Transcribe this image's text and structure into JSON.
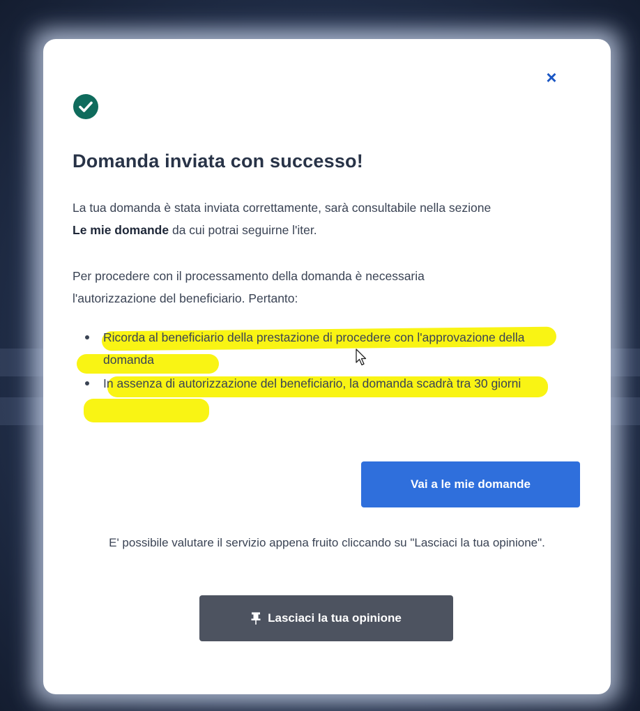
{
  "modal": {
    "close_label": "×",
    "icon": "check-circle-icon",
    "title": "Domanda inviata con successo!",
    "paragraph1": {
      "before": "La tua domanda è stata inviata correttamente, sarà consultabile nella sezione",
      "bold": "Le mie domande",
      "after": "da cui potrai seguirne l'iter."
    },
    "paragraph2": "Per procedere con il processamento della domanda è necessaria l'autorizzazione del beneficiario. Pertanto:",
    "bullets": [
      "Ricorda al beneficiario della prestazione di procedere con l'approvazione della domanda",
      "In assenza di autorizzazione del beneficiario, la domanda scadrà tra 30 giorni"
    ],
    "primary_button": "Vai a le mie domande",
    "feedback_text": "E' possibile valutare il servizio appena fruito cliccando su \"Lasciaci la tua opinione\".",
    "feedback_button": {
      "icon": "pin-icon",
      "label": "Lasciaci la tua opinione"
    }
  },
  "colors": {
    "success": "#0f6b5c",
    "primary": "#2f6fdc",
    "dark_button": "#4d5360",
    "highlight": "#f8f300",
    "close": "#1a56c4"
  }
}
